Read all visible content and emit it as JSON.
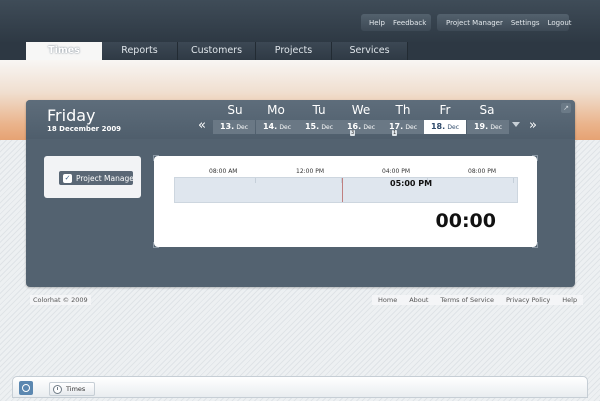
{
  "header": {
    "util_links_left": [
      "Help",
      "Feedback"
    ],
    "util_links_right": [
      "Project Manager",
      "Settings",
      "Logout"
    ]
  },
  "nav": {
    "tabs": [
      "Times",
      "Reports",
      "Customers",
      "Projects",
      "Services"
    ],
    "active": "Times"
  },
  "day_panel": {
    "day_title": "Friday",
    "date_subtitle": "18 December 2009",
    "prev_label": "«",
    "next_label": "»",
    "close_label": "↗",
    "weekdays": [
      "Su",
      "Mo",
      "Tu",
      "We",
      "Th",
      "Fr",
      "Sa"
    ],
    "dates": [
      {
        "day": "13.",
        "month": "Dec",
        "count": ""
      },
      {
        "day": "14.",
        "month": "Dec",
        "count": ""
      },
      {
        "day": "15.",
        "month": "Dec",
        "count": ""
      },
      {
        "day": "16.",
        "month": "Dec",
        "count": "3"
      },
      {
        "day": "17.",
        "month": "Dec",
        "count": "1"
      },
      {
        "day": "18.",
        "month": "Dec",
        "count": ""
      },
      {
        "day": "19.",
        "month": "Dec",
        "count": ""
      }
    ],
    "selected_date_index": 5
  },
  "project": {
    "checked": true,
    "check_glyph": "✓",
    "label": "Project Manager"
  },
  "timeline": {
    "ticks": [
      "08:00 AM",
      "12:00 PM",
      "04:00 PM",
      "08:00 PM"
    ],
    "marker_time": "05:00 PM",
    "total": "00:00"
  },
  "footer": {
    "copyright": "Colorhat © 2009",
    "links": [
      "Home",
      "About",
      "Terms of Service",
      "Privacy Policy",
      "Help"
    ]
  },
  "taskbar": {
    "item_label": "Times"
  },
  "colors": {
    "panel": "#536270",
    "topbar": "#2e3944",
    "accent_orange": "#e6a273",
    "selected_date_text": "#2f4a6a"
  }
}
